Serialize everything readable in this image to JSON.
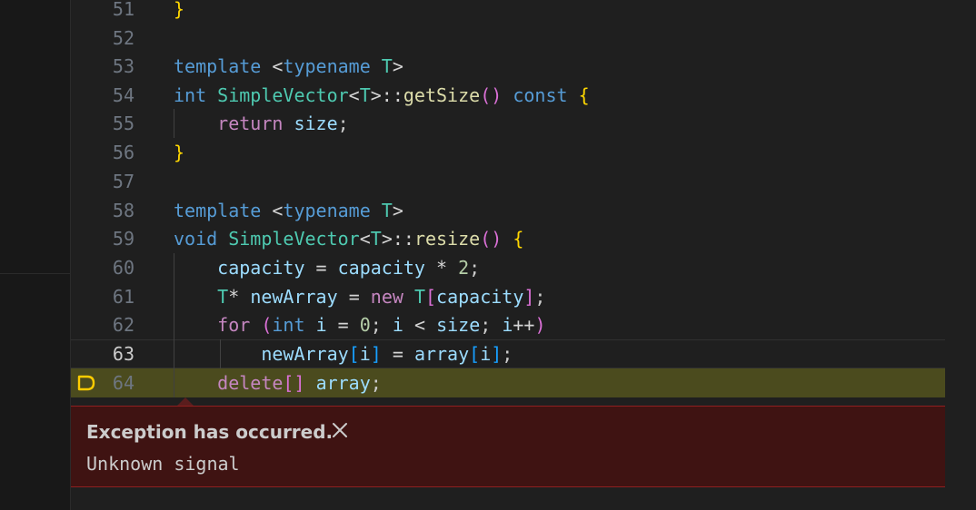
{
  "editor": {
    "lines": [
      {
        "number": "51",
        "text": "}"
      },
      {
        "number": "52",
        "text": ""
      },
      {
        "number": "53",
        "text": "template <typename T>"
      },
      {
        "number": "54",
        "text": "int SimpleVector<T>::getSize() const {"
      },
      {
        "number": "55",
        "text": "    return size;"
      },
      {
        "number": "56",
        "text": "}"
      },
      {
        "number": "57",
        "text": ""
      },
      {
        "number": "58",
        "text": "template <typename T>"
      },
      {
        "number": "59",
        "text": "void SimpleVector<T>::resize() {"
      },
      {
        "number": "60",
        "text": "    capacity = capacity * 2;"
      },
      {
        "number": "61",
        "text": "    T* newArray = new T[capacity];"
      },
      {
        "number": "62",
        "text": "    for (int i = 0; i < size; i++)"
      },
      {
        "number": "63",
        "text": "        newArray[i] = array[i];"
      },
      {
        "number": "64",
        "text": "    delete[] array;"
      }
    ],
    "current_line": "63",
    "stopped_line": "64"
  },
  "exception": {
    "title": "Exception has occurred.",
    "message": "Unknown signal",
    "close_icon": "close-icon",
    "colors": {
      "background": "#3f1312",
      "border": "#8f2020"
    }
  },
  "colors": {
    "keyword": "#569cd6",
    "control": "#c586c0",
    "function": "#dcdcaa",
    "type": "#4ec9b0",
    "variable": "#9cdcfe",
    "number": "#b5cea8",
    "stopped_highlight": "#4b4b1e"
  }
}
